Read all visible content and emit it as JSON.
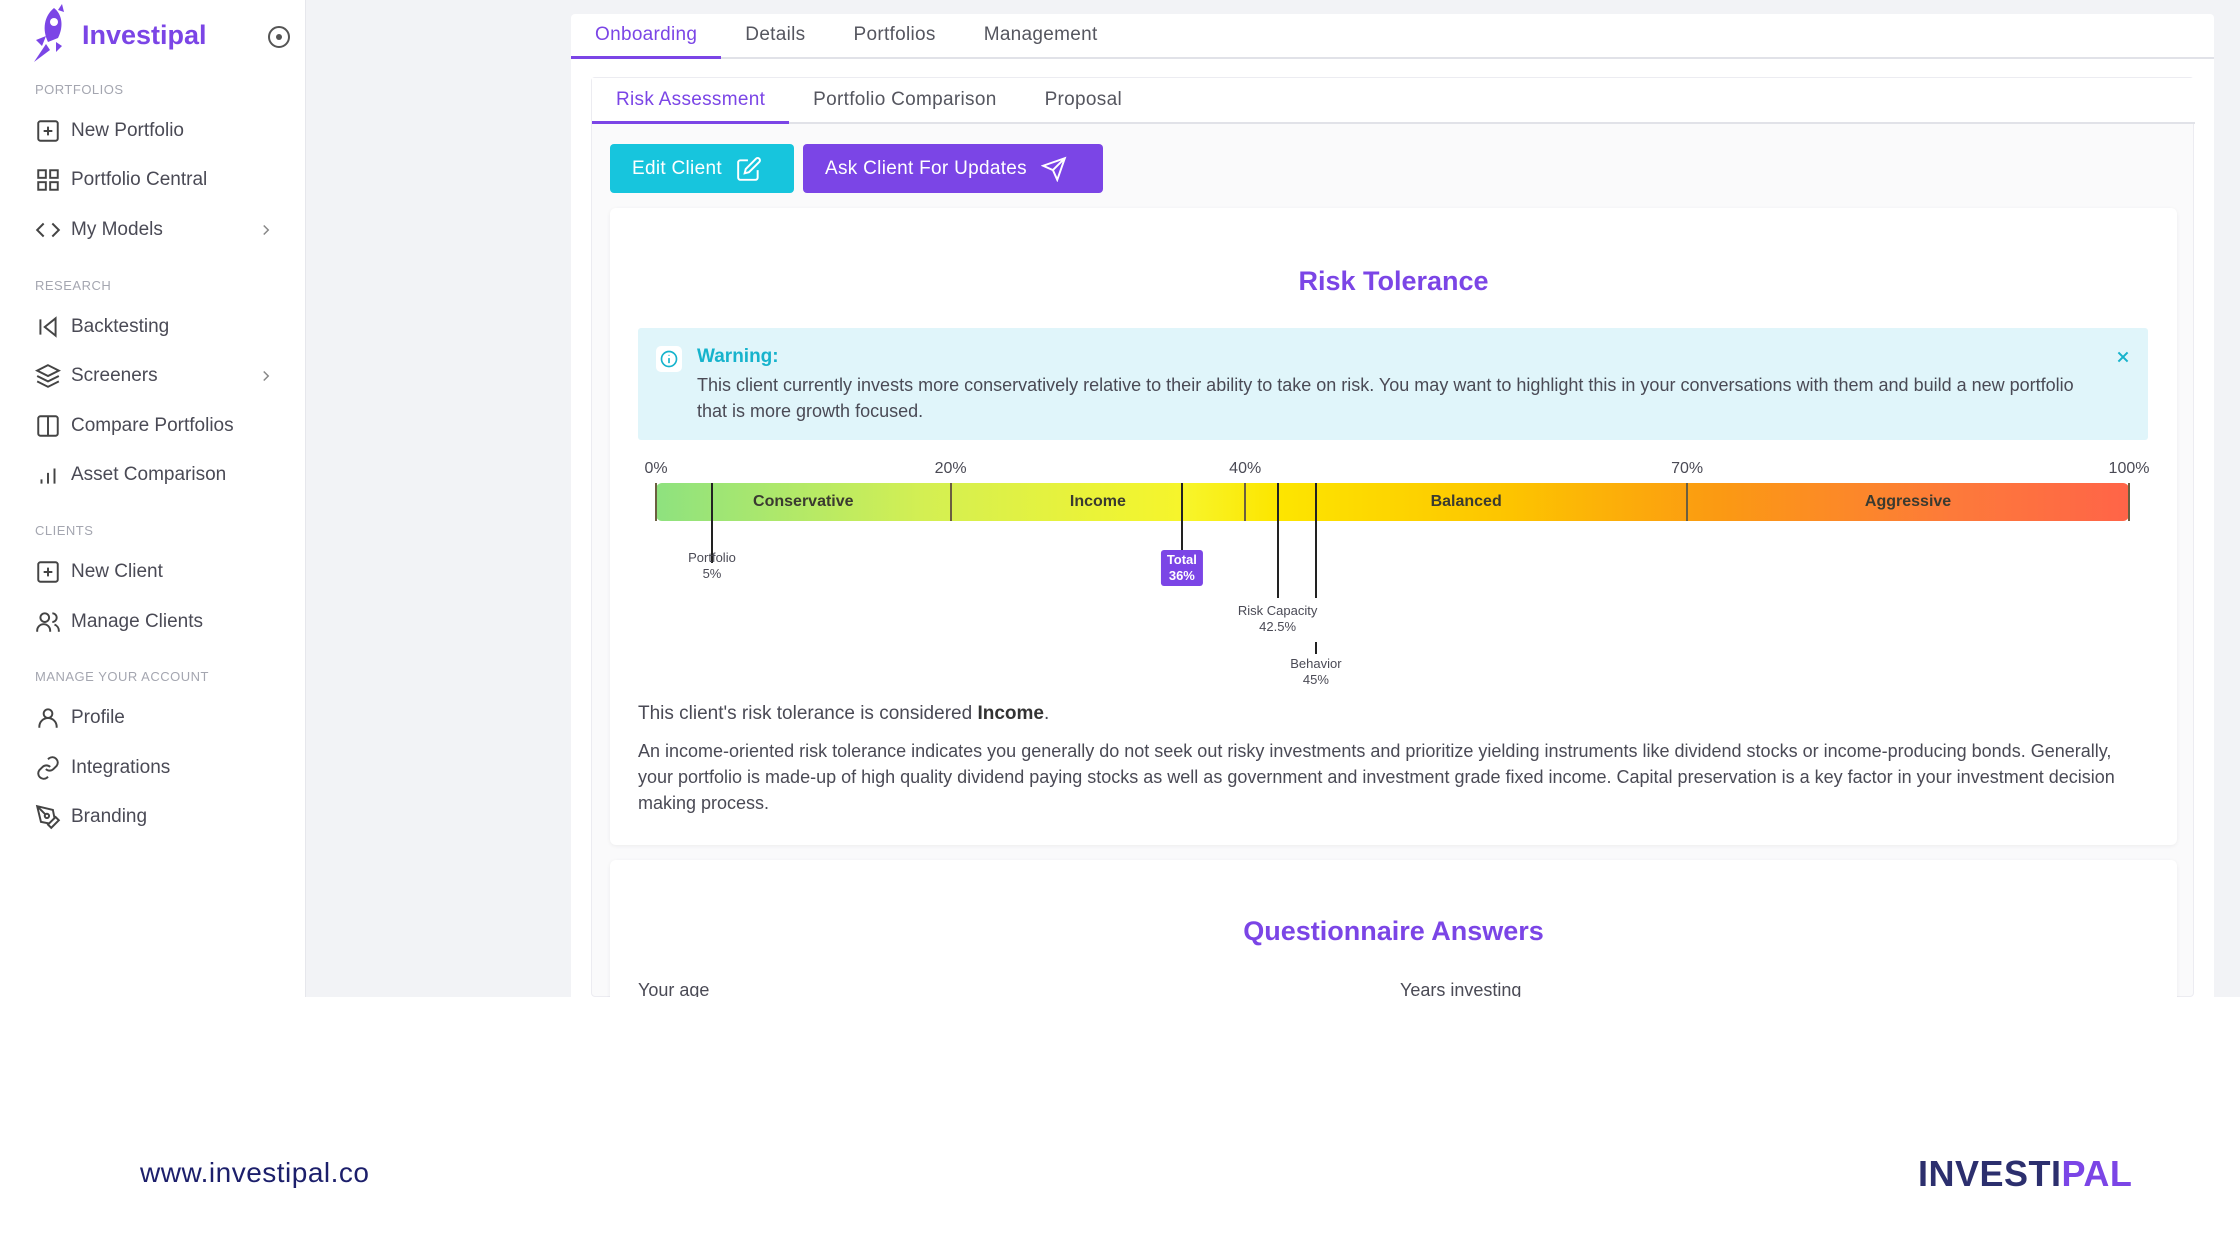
{
  "app": {
    "brand": "Investipal"
  },
  "sidebar": {
    "sections": [
      {
        "label": "PORTFOLIOS",
        "items": [
          {
            "label": "New Portfolio",
            "icon": "plus-square-icon"
          },
          {
            "label": "Portfolio Central",
            "icon": "grid-icon"
          },
          {
            "label": "My Models",
            "icon": "code-icon"
          }
        ]
      },
      {
        "label": "RESEARCH",
        "items": [
          {
            "label": "Backtesting",
            "icon": "skip-back-icon"
          },
          {
            "label": "Screeners",
            "icon": "layers-icon"
          },
          {
            "label": "Compare Portfolios",
            "icon": "columns-icon"
          },
          {
            "label": "Asset Comparison",
            "icon": "bar-chart-icon"
          }
        ]
      },
      {
        "label": "CLIENTS",
        "items": [
          {
            "label": "New Client",
            "icon": "plus-square-icon"
          },
          {
            "label": "Manage Clients",
            "icon": "users-icon"
          }
        ]
      },
      {
        "label": "MANAGE YOUR ACCOUNT",
        "items": [
          {
            "label": "Profile",
            "icon": "user-icon"
          },
          {
            "label": "Integrations",
            "icon": "link-icon"
          },
          {
            "label": "Branding",
            "icon": "pen-tool-icon"
          }
        ]
      }
    ]
  },
  "top_tabs": [
    "Onboarding",
    "Details",
    "Portfolios",
    "Management"
  ],
  "sub_tabs": [
    "Risk Assessment",
    "Portfolio Comparison",
    "Proposal"
  ],
  "actions": {
    "edit_client": "Edit Client",
    "ask_client": "Ask Client For Updates"
  },
  "risk": {
    "title": "Risk Tolerance",
    "warning_title": "Warning:",
    "warning_body": "This client currently invests more conservatively relative to their ability to take on risk. You may want to highlight this in your conversations with them and build a new portfolio that is more growth focused.",
    "scale": {
      "ticks": [
        {
          "label": "0%",
          "value": 0
        },
        {
          "label": "20%",
          "value": 20
        },
        {
          "label": "40%",
          "value": 40
        },
        {
          "label": "70%",
          "value": 70
        },
        {
          "label": "100%",
          "value": 100
        }
      ],
      "bands": [
        {
          "label": "Conservative",
          "from": 0,
          "to": 20
        },
        {
          "label": "Income",
          "from": 20,
          "to": 40
        },
        {
          "label": "Balanced",
          "from": 40,
          "to": 70
        },
        {
          "label": "Aggressive",
          "from": 70,
          "to": 100
        }
      ],
      "markers": [
        {
          "name": "Portfolio",
          "value_label": "5%",
          "value": 3.8,
          "highlight": false
        },
        {
          "name": "Total",
          "value_label": "36%",
          "value": 35.7,
          "highlight": true
        },
        {
          "name": "Risk Capacity",
          "value_label": "42.5%",
          "value": 42.2,
          "highlight": false
        },
        {
          "name": "Behavior",
          "value_label": "45%",
          "value": 44.8,
          "highlight": false
        }
      ]
    },
    "summary_prefix": "This client's risk tolerance is considered ",
    "summary_value": "Income",
    "summary_suffix": ".",
    "description": "An income-oriented risk tolerance indicates you generally do not seek out risky investments and prioritize yielding instruments like dividend stocks or income-producing bonds. Generally, your portfolio is made-up of high quality dividend paying stocks as well as government and investment grade fixed income. Capital preservation is a key factor in your investment decision making process."
  },
  "questionnaire": {
    "title": "Questionnaire Answers",
    "left_label": "Your age",
    "right_label": "Years investing"
  },
  "footer": {
    "url": "www.investipal.co",
    "logo_part1": "INVESTI",
    "logo_part2": "PAL"
  },
  "colors": {
    "accent": "#7b45e6",
    "cyan": "#17c5dd",
    "warning_bg": "#e0f5fa"
  }
}
